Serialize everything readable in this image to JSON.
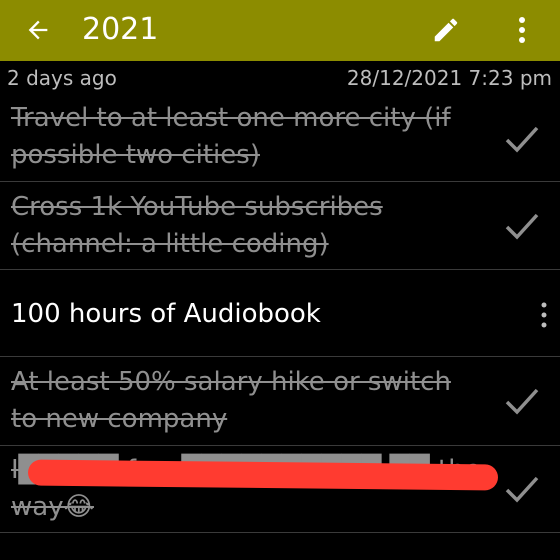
{
  "header": {
    "title": "2021",
    "back_icon": "arrow-left-icon",
    "edit_icon": "pencil-icon",
    "more_icon": "more-vert-icon"
  },
  "meta": {
    "relative_time": "2 days ago",
    "timestamp": "28/12/2021 7:23 pm"
  },
  "items": [
    {
      "text": "Travel to at least one more city (if possible two cities)",
      "done": true
    },
    {
      "text": "Cross 1k YouTube subscribes (channel: a little coding)",
      "done": true
    },
    {
      "text": "100 hours of Audiobook",
      "done": false
    },
    {
      "text": "At least 50% salary hike or switch to new company",
      "done": true
    },
    {
      "text": "I█████ few ██████████ ██ the way😂",
      "done": true
    }
  ],
  "colors": {
    "appbar": "#8c8c00",
    "background": "#000000",
    "done_text": "#8f8f8f",
    "redaction": "#ff3b30"
  }
}
